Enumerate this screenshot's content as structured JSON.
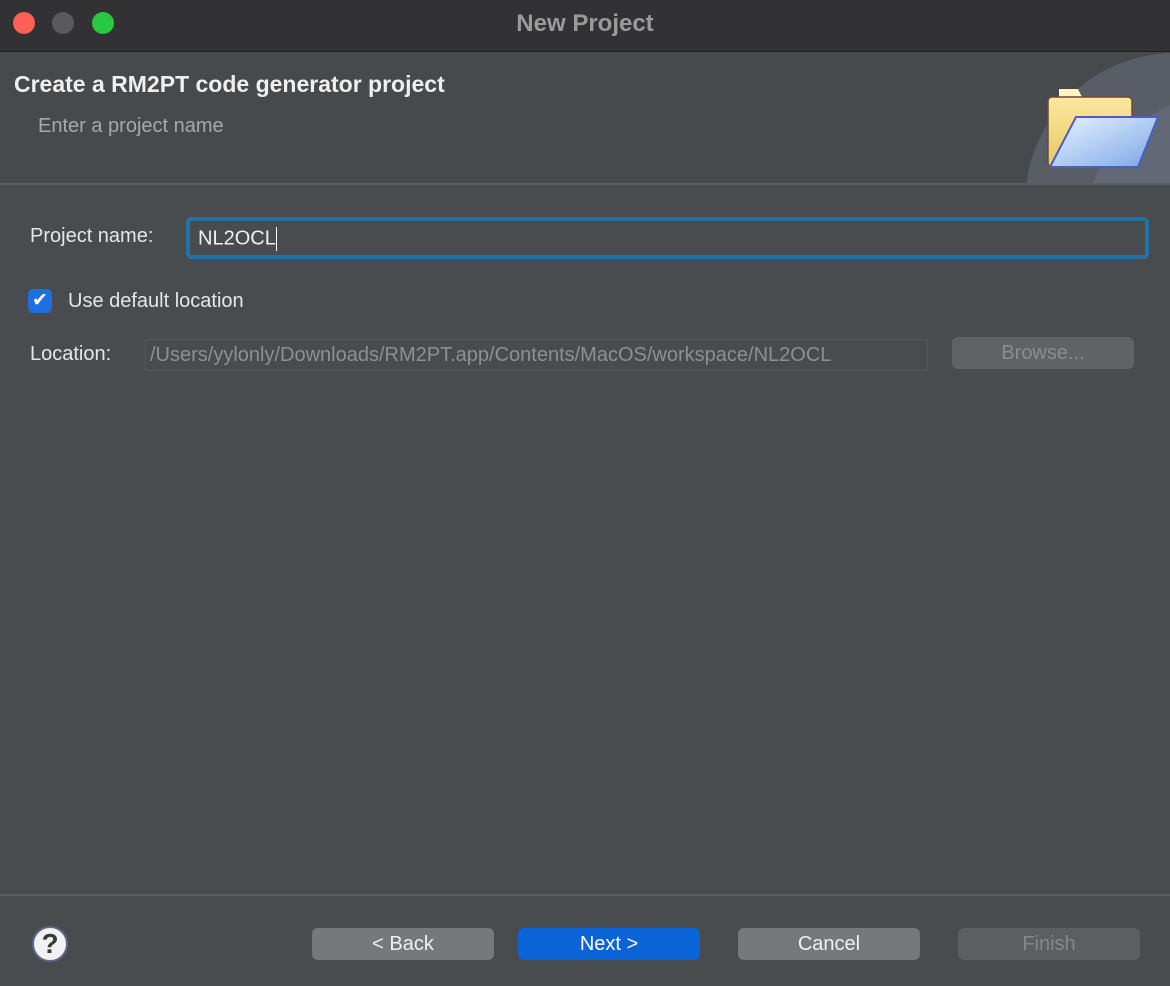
{
  "window": {
    "title": "New Project",
    "colors": {
      "close": "#fe5f57",
      "minimize": "#5a5a5c",
      "zoom": "#28c840"
    }
  },
  "header": {
    "title": "Create a RM2PT code generator project",
    "subtitle": "Enter a project name",
    "icon": "folder-open-icon"
  },
  "form": {
    "project_name_label": "Project name:",
    "project_name_value": "NL2OCL",
    "use_default_label": "Use default location",
    "use_default_checked": true,
    "location_label": "Location:",
    "location_value": "/Users/yylonly/Downloads/RM2PT.app/Contents/MacOS/workspace/NL2OCL",
    "browse_label": "Browse..."
  },
  "footer": {
    "help_icon": "?",
    "back": "< Back",
    "next": "Next >",
    "cancel": "Cancel",
    "finish": "Finish",
    "accent": "#0a64d8"
  }
}
